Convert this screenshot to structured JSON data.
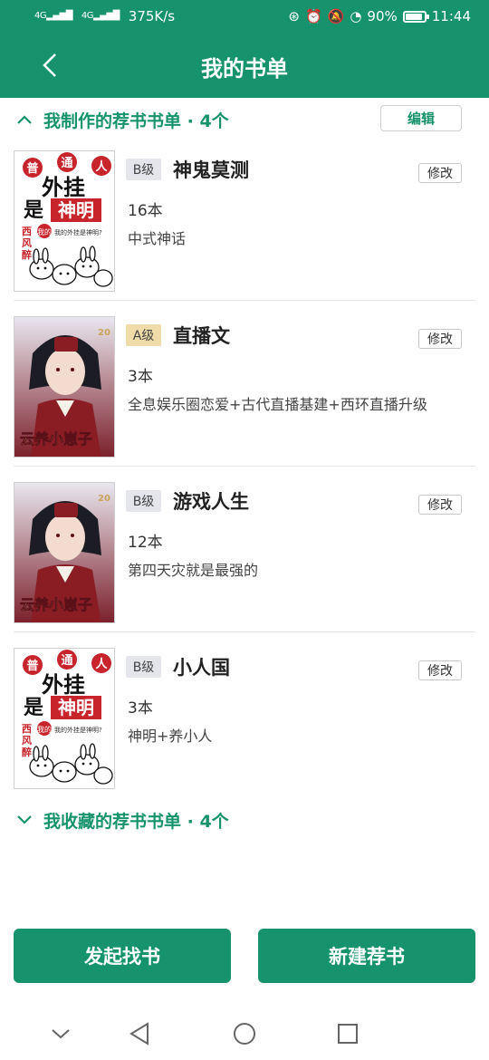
{
  "status_bar": {
    "signal1": "4G",
    "signal2": "4G",
    "speed": "375K/s",
    "battery": "90%",
    "battery_level": 0.9,
    "time": "11:44"
  },
  "header": {
    "title": "我的书单"
  },
  "my_lists": {
    "title": "我制作的荐书书单 · 4个",
    "edit_label": "编辑",
    "books": [
      {
        "level": "B级",
        "title": "神鬼莫测",
        "count": "16本",
        "desc": "中式神话",
        "cover": "cartoon"
      },
      {
        "level": "A级",
        "title": "直播文",
        "count": "3本",
        "desc": "全息娱乐圈恋爱+古代直播基建+西环直播升级",
        "cover": "anime"
      },
      {
        "level": "B级",
        "title": "游戏人生",
        "count": "12本",
        "desc": "第四天灾就是最强的",
        "cover": "anime"
      },
      {
        "level": "B级",
        "title": "小人国",
        "count": "3本",
        "desc": "神明+养小人",
        "cover": "cartoon"
      }
    ],
    "modify_label": "修改"
  },
  "fav_lists": {
    "title": "我收藏的荐书书单 · 4个"
  },
  "cover_cartoon": {
    "w1": "普",
    "w2": "通",
    "w3": "人",
    "line2": "外挂",
    "line3a": "是",
    "line3b": "神明",
    "author": "西风醉",
    "tag": "我的",
    "blurb": "我的外挂是神明?"
  },
  "cover_anime": {
    "text": "云养小崽子",
    "number": "20"
  },
  "buttons": {
    "find_book": "发起找书",
    "new_rec": "新建荐书"
  },
  "colors": {
    "brand": "#16936c",
    "badge_a": "#efdca8",
    "badge_b": "#e4e6ec"
  }
}
